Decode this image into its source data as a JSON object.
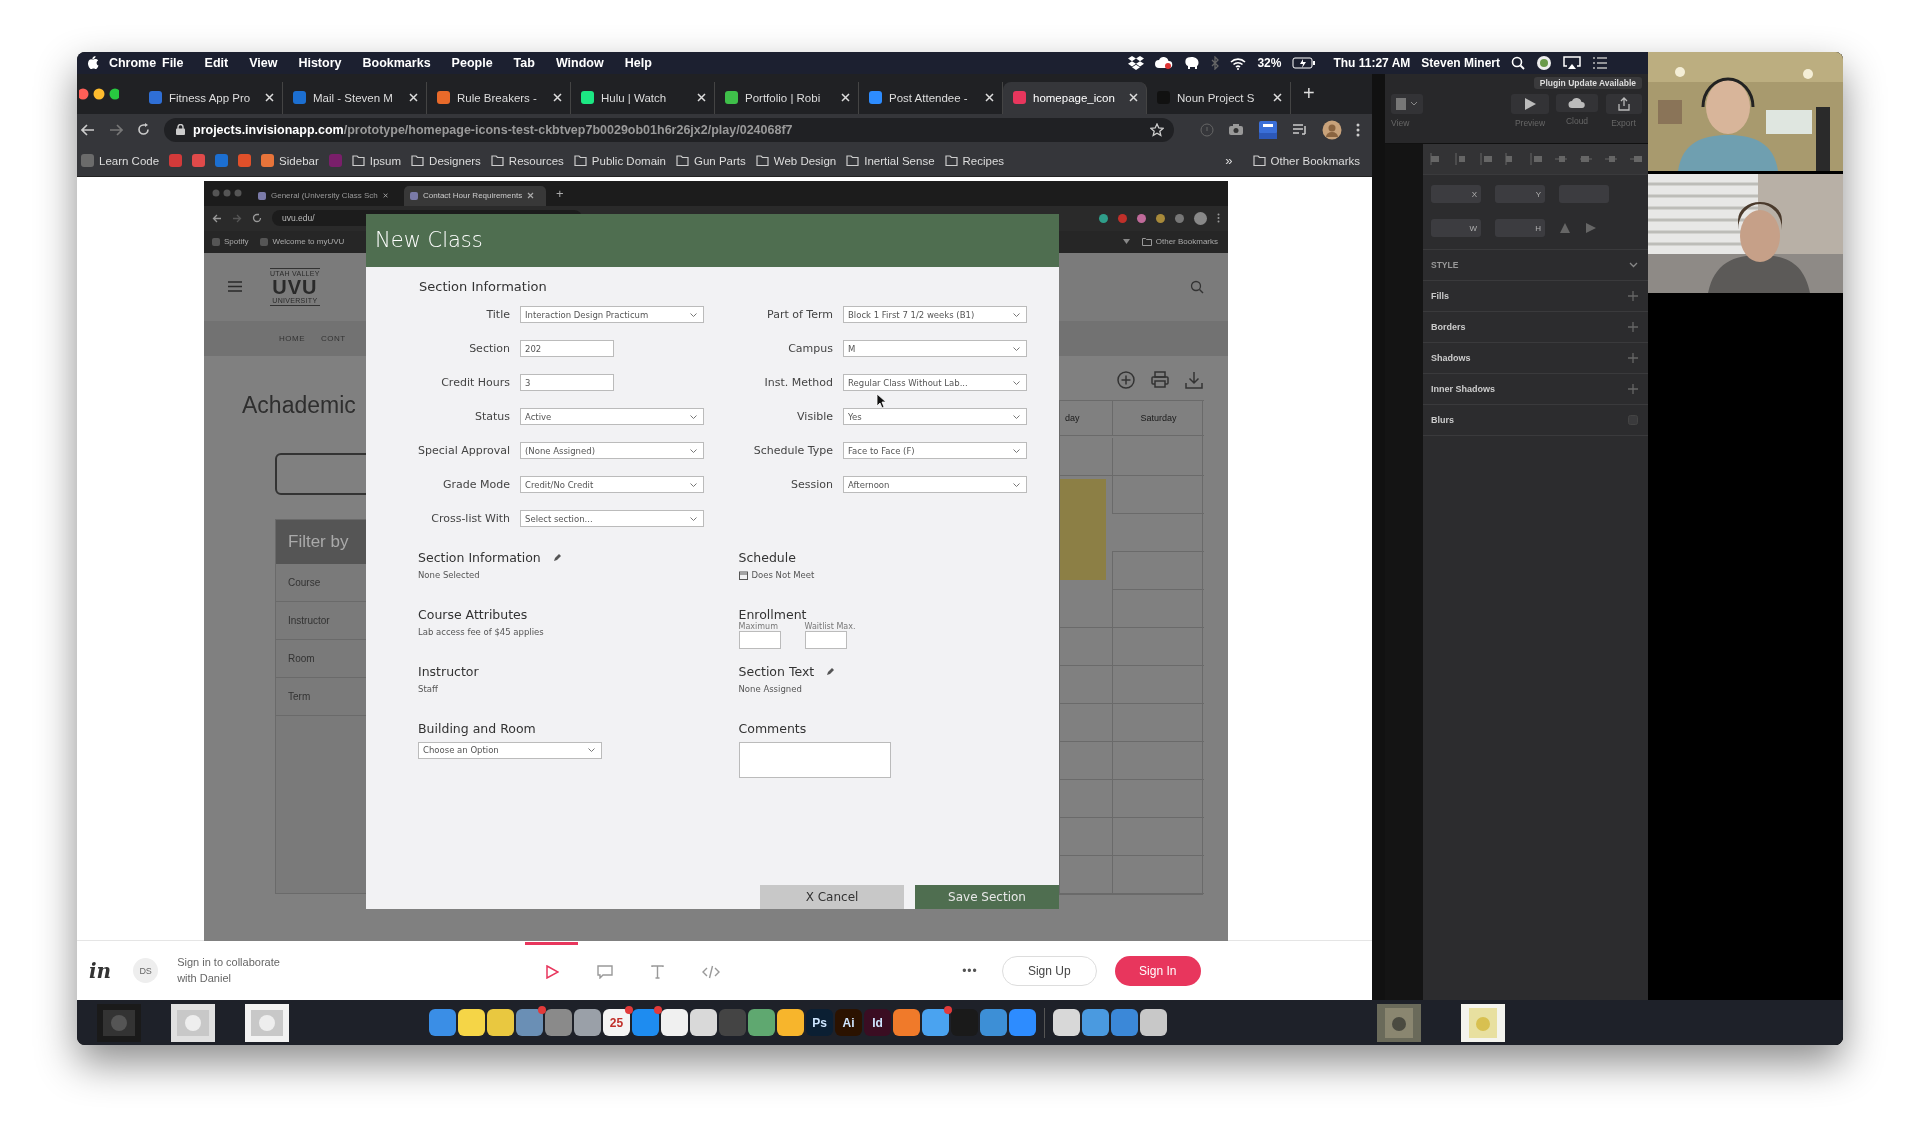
{
  "menu_bar": {
    "app": "Chrome",
    "menus": [
      "File",
      "Edit",
      "View",
      "History",
      "Bookmarks",
      "People",
      "Tab",
      "Window",
      "Help"
    ],
    "battery": "32%",
    "clock": "Thu 11:27 AM",
    "user": "Steven Minert"
  },
  "browser": {
    "tabs": [
      {
        "title": "Fitness App Pro",
        "selected": false,
        "color": "#2f6fd6"
      },
      {
        "title": "Mail - Steven M",
        "selected": false,
        "color": "#1c6fd1"
      },
      {
        "title": "Rule Breakers -",
        "selected": false,
        "color": "#e86a2a"
      },
      {
        "title": "Hulu | Watch",
        "selected": false,
        "color": "#1ce783"
      },
      {
        "title": "Portfolio | Robi",
        "selected": false,
        "color": "#3fbf4a"
      },
      {
        "title": "Post Attendee -",
        "selected": false,
        "color": "#2d8cff"
      },
      {
        "title": "homepage_icon",
        "selected": true,
        "color": "#e8365d"
      },
      {
        "title": "Noun Project S",
        "selected": false,
        "color": "#111111"
      }
    ],
    "new_tab": "+",
    "address": {
      "domain": "projects.invisionapp.com",
      "path": "/prototype/homepage-icons-test-ckbtvep7b0029ob01h6r26jx2/play/024068f7"
    },
    "bookmarks": [
      {
        "kind": "site",
        "label": "Learn Code",
        "color": "#6b6b6b"
      },
      {
        "kind": "site",
        "color": "#d23a3a"
      },
      {
        "kind": "site",
        "color": "#e04a4a"
      },
      {
        "kind": "site",
        "color": "#1c6fd1"
      },
      {
        "kind": "site",
        "color": "#e0502a"
      },
      {
        "kind": "site",
        "label": "Sidebar",
        "color": "#e8743a"
      },
      {
        "kind": "site",
        "color": "#7a1f6b"
      },
      {
        "kind": "folder",
        "label": "Ipsum"
      },
      {
        "kind": "folder",
        "label": "Designers"
      },
      {
        "kind": "folder",
        "label": "Resources"
      },
      {
        "kind": "folder",
        "label": "Public Domain"
      },
      {
        "kind": "folder",
        "label": "Gun Parts"
      },
      {
        "kind": "folder",
        "label": "Web Design"
      },
      {
        "kind": "folder",
        "label": "Inertial Sense"
      },
      {
        "kind": "folder",
        "label": "Recipes"
      }
    ],
    "overflow": "»",
    "other_bookmarks": "Other Bookmarks"
  },
  "prototype": {
    "inner_browser": {
      "tabs": [
        {
          "title": "General (University Class Sch",
          "selected": false
        },
        {
          "title": "Contact Hour Requirements",
          "selected": true
        }
      ],
      "new_tab": "+",
      "address": "uvu.edu/",
      "bookmarks": [
        "Spotify",
        "Welcome to myUVU"
      ],
      "other_bookmarks": "Other Bookmarks"
    },
    "site": {
      "logo": "UVU",
      "logo_top": "UTAH VALLEY",
      "logo_bottom": "UNIVERSITY",
      "nav": [
        "HOME",
        "CONT"
      ],
      "heading": "Achademic",
      "filter": {
        "title": "Filter by",
        "items": [
          "Course",
          "Instructor",
          "Room",
          "Term"
        ]
      },
      "calendar": {
        "columns": [
          "day",
          "Saturday"
        ]
      }
    },
    "modal": {
      "title": "New Class",
      "section_title": "Section Information",
      "fields_left": [
        {
          "label": "Title",
          "kind": "select",
          "value": "Interaction Design Practicum"
        },
        {
          "label": "Section",
          "kind": "text",
          "value": "202"
        },
        {
          "label": "Credit Hours",
          "kind": "text",
          "value": "3"
        },
        {
          "label": "Status",
          "kind": "select",
          "value": "Active"
        },
        {
          "label": "Special Approval",
          "kind": "select",
          "value": "(None Assigned)"
        },
        {
          "label": "Grade Mode",
          "kind": "select",
          "value": "Credit/No Credit"
        },
        {
          "label": "Cross-list With",
          "kind": "select",
          "value": "Select section..."
        }
      ],
      "fields_right": [
        {
          "label": "Part of Term",
          "kind": "select",
          "value": "Block 1 First 7 1/2 weeks (B1)"
        },
        {
          "label": "Campus",
          "kind": "select",
          "value": "M"
        },
        {
          "label": "Inst. Method",
          "kind": "select",
          "value": "Regular Class Without Lab..."
        },
        {
          "label": "Visible",
          "kind": "select",
          "value": "Yes"
        },
        {
          "label": "Schedule Type",
          "kind": "select",
          "value": "Face to Face (F)"
        },
        {
          "label": "Session",
          "kind": "select",
          "value": "Afternoon"
        }
      ],
      "sections_left": [
        {
          "title": "Section Information",
          "kind": "editable",
          "text": "None Selected"
        },
        {
          "title": "Course Attributes",
          "kind": "plain",
          "text": "Lab access fee of $45 applies"
        },
        {
          "title": "Instructor",
          "kind": "plain",
          "text": "Staff"
        },
        {
          "title": "Building and Room",
          "kind": "select",
          "text": "Choose an Option"
        }
      ],
      "sections_right": [
        {
          "title": "Schedule",
          "kind": "calendar",
          "text": "Does Not Meet"
        },
        {
          "title": "Enrollment",
          "kind": "inputs",
          "inputs": [
            "Maximum",
            "Waitlist Max."
          ]
        },
        {
          "title": "Section Text",
          "kind": "editable",
          "text": "None Assigned"
        },
        {
          "title": "Comments",
          "kind": "textarea"
        }
      ],
      "cancel": "X Cancel",
      "save": "Save Section"
    }
  },
  "invision_bar": {
    "logo": "in",
    "avatar": "DS",
    "message": "Sign in to collaborate with Daniel",
    "modes": [
      {
        "kind": "play",
        "selected": true
      },
      {
        "kind": "comment",
        "selected": false
      },
      {
        "kind": "text",
        "selected": false
      },
      {
        "kind": "code",
        "selected": false
      }
    ],
    "more": "•••",
    "sign_up": "Sign Up",
    "sign_in": "Sign In"
  },
  "sketch": {
    "notice": "Plugin Update Available",
    "toolbar": [
      {
        "kind": "view",
        "label": "View"
      },
      {
        "kind": "preview",
        "label": "Preview"
      },
      {
        "kind": "cloud",
        "label": "Cloud"
      },
      {
        "kind": "export",
        "label": "Export"
      }
    ],
    "fields": [
      "X",
      "Y",
      "W",
      "H"
    ],
    "style_title": "STYLE",
    "sections": [
      {
        "label": "Fills",
        "kind": "add"
      },
      {
        "label": "Borders",
        "kind": "add"
      },
      {
        "label": "Shadows",
        "kind": "add"
      },
      {
        "label": "Inner Shadows",
        "kind": "add"
      },
      {
        "label": "Blurs",
        "kind": "toggle"
      }
    ]
  },
  "dock": {
    "items": [
      {
        "color": "#3a8ee6",
        "badge": false
      },
      {
        "color": "#f5d547",
        "badge": false
      },
      {
        "color": "#e9c840",
        "badge": false
      },
      {
        "color": "#6a8fb5",
        "badge": true
      },
      {
        "color": "#8a8a8a",
        "badge": false
      },
      {
        "color": "#9aa0a8",
        "badge": false
      },
      {
        "color": "#f4f4f4",
        "label": "25",
        "badge": true
      },
      {
        "color": "#1e8cf0",
        "badge": true
      },
      {
        "color": "#f0f0f0",
        "badge": false
      },
      {
        "color": "#d9d9d9",
        "badge": false
      },
      {
        "color": "#444444",
        "badge": false
      },
      {
        "color": "#5fa870",
        "badge": false
      },
      {
        "color": "#f7b52c",
        "badge": false
      },
      {
        "color": "#0b1f33",
        "label": "Ps",
        "badge": false
      },
      {
        "color": "#2b1200",
        "label": "Ai",
        "badge": false
      },
      {
        "color": "#3a0d22",
        "label": "Id",
        "badge": false
      },
      {
        "color": "#f07a2a",
        "badge": false
      },
      {
        "color": "#4aa3f0",
        "badge": true
      },
      {
        "color": "#1a1a1a",
        "badge": false
      },
      {
        "color": "#3d8fd6",
        "badge": false
      },
      {
        "color": "#2d8cff",
        "badge": false
      },
      {
        "color": "#d8d8d8",
        "badge": false
      },
      {
        "color": "#4a9ae0",
        "badge": false
      },
      {
        "color": "#3b88d8",
        "badge": false
      },
      {
        "color": "#c8c8c8",
        "badge": false
      }
    ]
  }
}
